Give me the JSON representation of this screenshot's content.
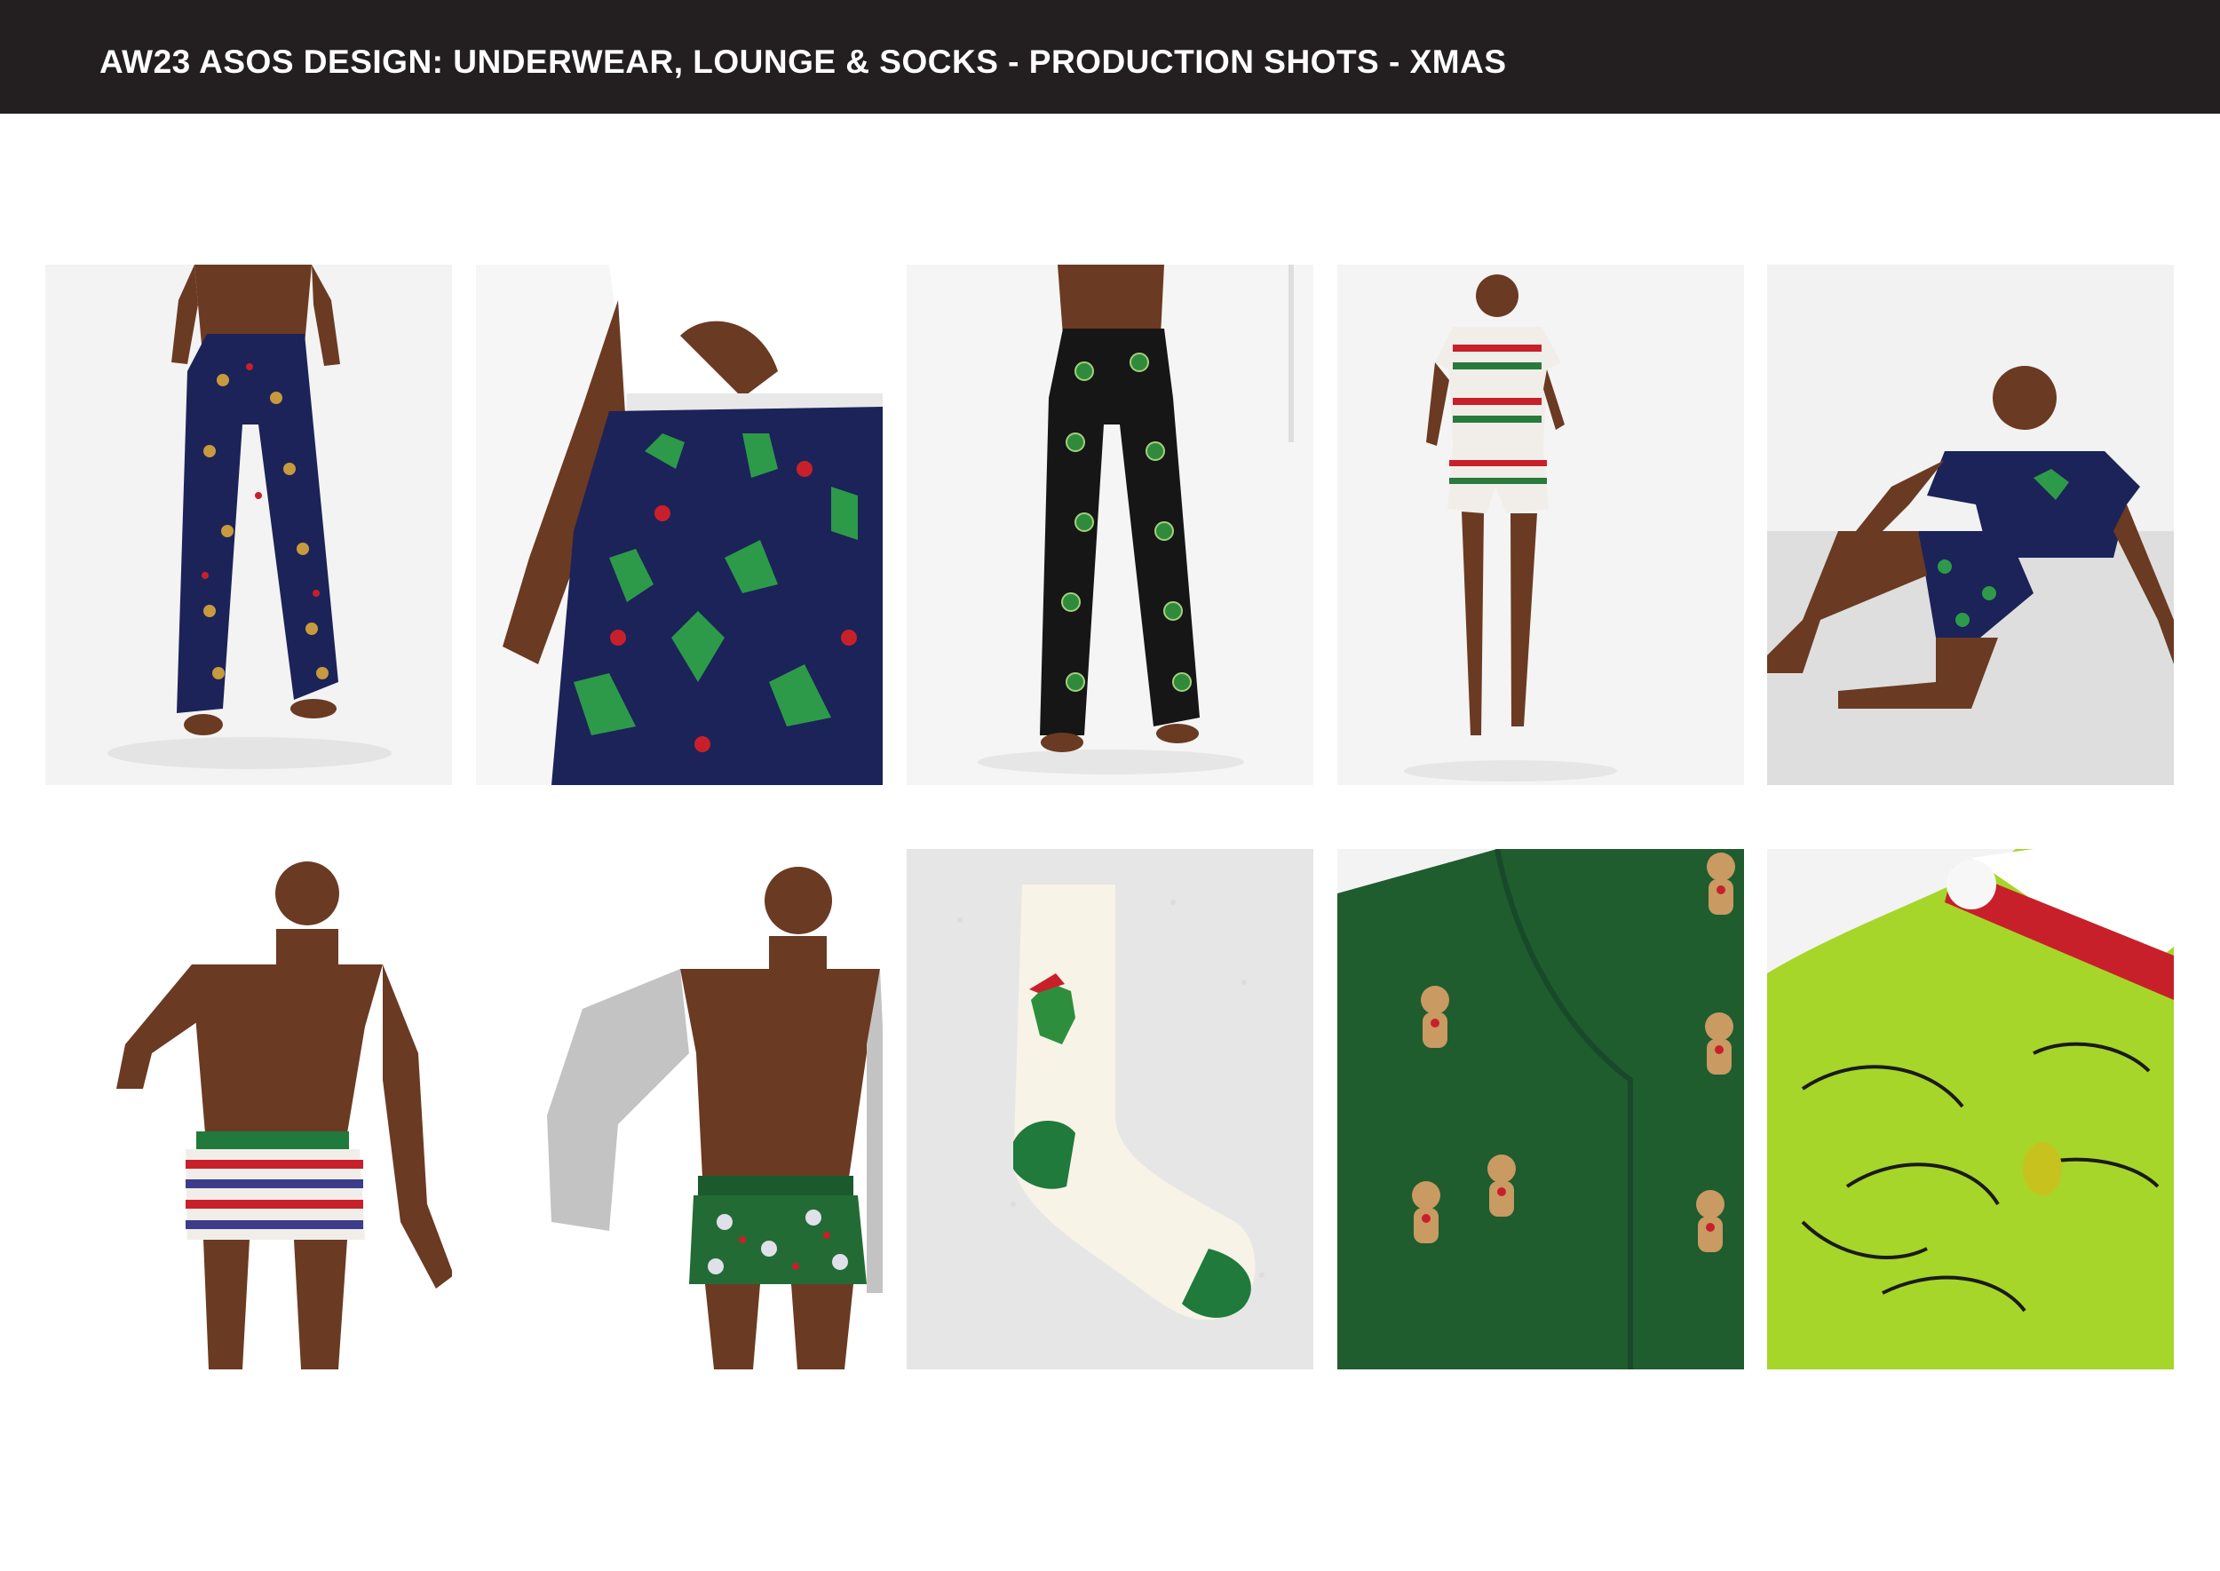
{
  "header": {
    "title": "AW23 ASOS DESIGN: UNDERWEAR, LOUNGE & SOCKS - PRODUCTION SHOTS - XMAS"
  },
  "colors": {
    "header_bg": "#231f20",
    "header_text": "#ffffff",
    "navy": "#1c2358",
    "black_print": "#161616",
    "forest_green": "#1f5c2e",
    "lime": "#a6d62a",
    "red": "#c8202a",
    "skin": "#6b3a22"
  },
  "tiles": [
    {
      "id": "navy-reindeer-lounge-pants",
      "row": 1,
      "col": 1
    },
    {
      "id": "navy-dino-lounge-pants-closeup",
      "row": 1,
      "col": 2
    },
    {
      "id": "black-sprout-lounge-pants",
      "row": 1,
      "col": 3
    },
    {
      "id": "fairisle-tee-and-shorts-set",
      "row": 1,
      "col": 4
    },
    {
      "id": "navy-tee-and-dino-shorts-set",
      "row": 1,
      "col": 5
    },
    {
      "id": "fairisle-trunks",
      "row": 2,
      "col": 1
    },
    {
      "id": "green-print-trunks",
      "row": 2,
      "col": 2
    },
    {
      "id": "white-dino-sock",
      "row": 2,
      "col": 3
    },
    {
      "id": "green-gingerbread-socks-closeup",
      "row": 2,
      "col": 4
    },
    {
      "id": "lime-grinch-socks-closeup",
      "row": 2,
      "col": 5
    }
  ]
}
